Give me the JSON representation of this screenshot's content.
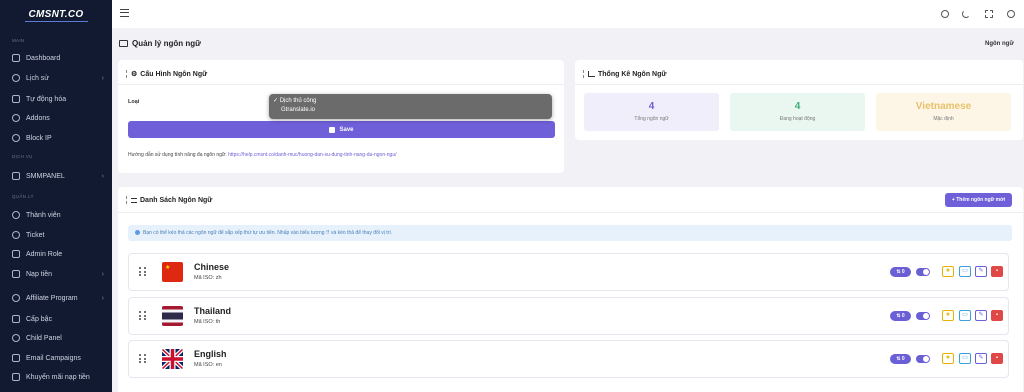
{
  "app": {
    "logo_text": "CMSNT.CO"
  },
  "sidebar": {
    "sections": {
      "main": "MAIN",
      "service": "DỊCH VỤ",
      "admin": "QUẢN LÝ"
    },
    "items": [
      {
        "label": "Dashboard",
        "icon": "dashboard-icon",
        "arrow": false
      },
      {
        "label": "Lịch sử",
        "icon": "clock-icon",
        "arrow": true
      },
      {
        "label": "Tự động hóa",
        "icon": "calendar-icon",
        "arrow": false
      },
      {
        "label": "Addons",
        "icon": "plus-circle-icon",
        "arrow": false
      },
      {
        "label": "Block IP",
        "icon": "ban-icon",
        "arrow": false
      },
      {
        "label": "SMMPANEL",
        "icon": "cart-icon",
        "arrow": true
      },
      {
        "label": "Thành viên",
        "icon": "users-icon",
        "arrow": false
      },
      {
        "label": "Ticket",
        "icon": "headset-icon",
        "arrow": false
      },
      {
        "label": "Admin Role",
        "icon": "shield-icon",
        "arrow": false
      },
      {
        "label": "Nạp tiền",
        "icon": "wallet-icon",
        "arrow": true
      },
      {
        "label": "Affiliate Program",
        "icon": "affiliate-icon",
        "arrow": true
      },
      {
        "label": "Cấp bậc",
        "icon": "rank-icon",
        "arrow": false
      },
      {
        "label": "Child Panel",
        "icon": "panel-icon",
        "arrow": false
      },
      {
        "label": "Email Campaigns",
        "icon": "mail-icon",
        "arrow": false
      },
      {
        "label": "Khuyến mãi nạp tiền",
        "icon": "percent-icon",
        "arrow": false
      }
    ]
  },
  "page": {
    "title": "Quản lý ngôn ngữ",
    "breadcrumb": "Ngôn ngữ"
  },
  "config_card": {
    "title": "Cấu Hình Ngôn Ngữ",
    "type_label": "Loại",
    "dropdown_options": [
      {
        "label": "Dịch thủ công",
        "selected": true
      },
      {
        "label": "Gtranslate.io",
        "selected": false
      }
    ],
    "save_label": "Save",
    "guide_text": "Hướng dẫn sử dụng tính năng đa ngôn ngữ:",
    "guide_link": "https://help.cmsnt.co/danh-muc/huong-dan-su-dung-tinh-nang-da-ngon-ngu/"
  },
  "stats_card": {
    "title": "Thống Kê Ngôn Ngữ",
    "stats": [
      {
        "value": "4",
        "label": "Tổng ngôn ngữ",
        "color": "#6b5fd6",
        "bg": "#efeefa"
      },
      {
        "value": "4",
        "label": "Đang hoạt động",
        "color": "#3fae7a",
        "bg": "#eaf6f0"
      },
      {
        "value": "Vietnamese",
        "label": "Mặc định",
        "color": "#e8c06a",
        "bg": "#fdf6e6"
      }
    ]
  },
  "list_card": {
    "title": "Danh Sách Ngôn Ngữ",
    "add_label": "+ Thêm ngôn ngữ mới",
    "info": "Bạn có thể kéo thả các ngôn ngữ để sắp xếp thứ tự ưu tiên. Nhấp vào biểu tượng ⠿ và kéo thả để thay đổi vị trí.",
    "languages": [
      {
        "name": "Chinese",
        "iso": "Mã ISO: zh",
        "order": "⇅ 0"
      },
      {
        "name": "Thailand",
        "iso": "Mã ISO: th",
        "order": "⇅ 0"
      },
      {
        "name": "English",
        "iso": "Mã ISO: en",
        "order": "⇅ 0"
      }
    ]
  }
}
